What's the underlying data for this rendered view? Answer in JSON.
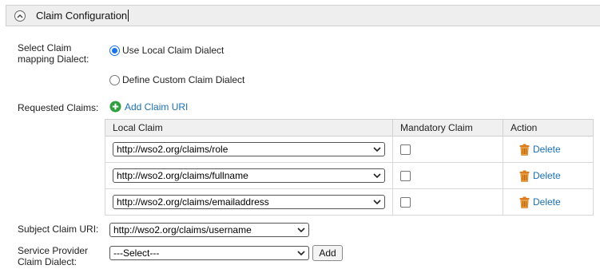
{
  "section": {
    "title": "Claim Configuration"
  },
  "dialect": {
    "label_line1": "Select Claim",
    "label_line2": "mapping Dialect:",
    "options": [
      {
        "label": "Use Local Claim Dialect",
        "selected": true
      },
      {
        "label": "Define Custom Claim Dialect",
        "selected": false
      }
    ]
  },
  "requested_claims": {
    "label": "Requested Claims:",
    "add_link": "Add Claim URI",
    "columns": [
      "Local Claim",
      "Mandatory Claim",
      "Action"
    ],
    "rows": [
      {
        "claim": "http://wso2.org/claims/role",
        "mandatory": false,
        "action": "Delete"
      },
      {
        "claim": "http://wso2.org/claims/fullname",
        "mandatory": false,
        "action": "Delete"
      },
      {
        "claim": "http://wso2.org/claims/emailaddress",
        "mandatory": false,
        "action": "Delete"
      }
    ]
  },
  "subject_claim": {
    "label": "Subject Claim URI:",
    "value": "http://wso2.org/claims/username"
  },
  "sp_dialect": {
    "label_line1": "Service Provider",
    "label_line2": "Claim Dialect:",
    "value": "---Select---",
    "add_button": "Add"
  },
  "colors": {
    "link": "#1a6fb0",
    "radio_accent": "#1a73e8",
    "add_icon": "#2e9e3e",
    "delete_icon": "#e07b1a",
    "header_bg": "#eeeeee"
  }
}
